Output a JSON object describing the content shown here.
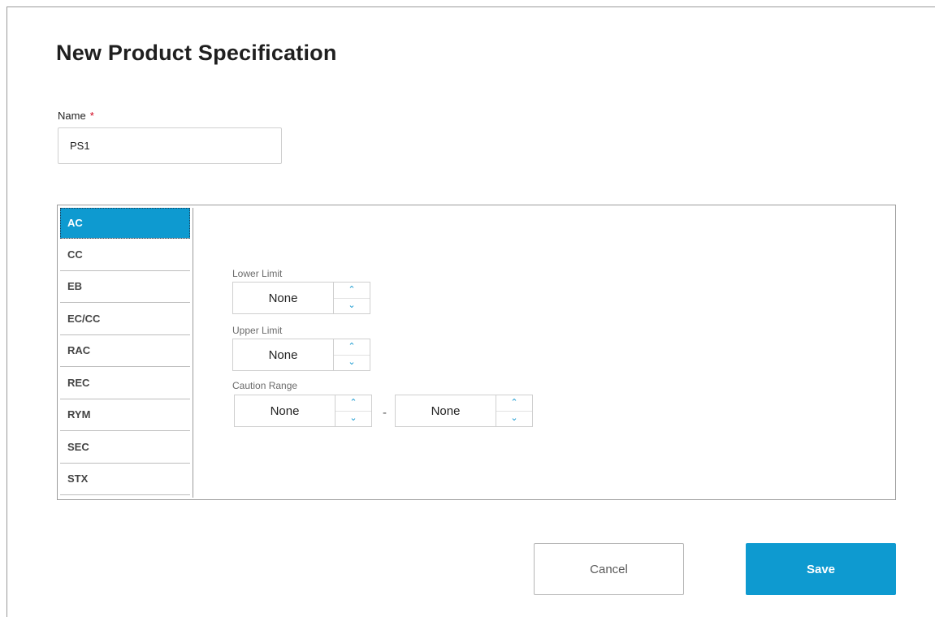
{
  "page": {
    "title": "New Product Specification"
  },
  "name_field": {
    "label": "Name",
    "required_marker": "*",
    "value": "PS1"
  },
  "spec_list": {
    "items": [
      "AC",
      "CC",
      "EB",
      "EC/CC",
      "RAC",
      "REC",
      "RYM",
      "SEC",
      "STX"
    ],
    "selected": "AC"
  },
  "limits": {
    "lower": {
      "label": "Lower Limit",
      "value": "None"
    },
    "upper": {
      "label": "Upper Limit",
      "value": "None"
    },
    "caution": {
      "label": "Caution Range",
      "from": "None",
      "separator": "-",
      "to": "None"
    }
  },
  "icons": {
    "increment": "chevron-up-icon",
    "decrement": "chevron-down-icon"
  },
  "colors": {
    "accent": "#0e9ad0",
    "required": "#d0021b"
  },
  "actions": {
    "cancel_label": "Cancel",
    "save_label": "Save"
  }
}
